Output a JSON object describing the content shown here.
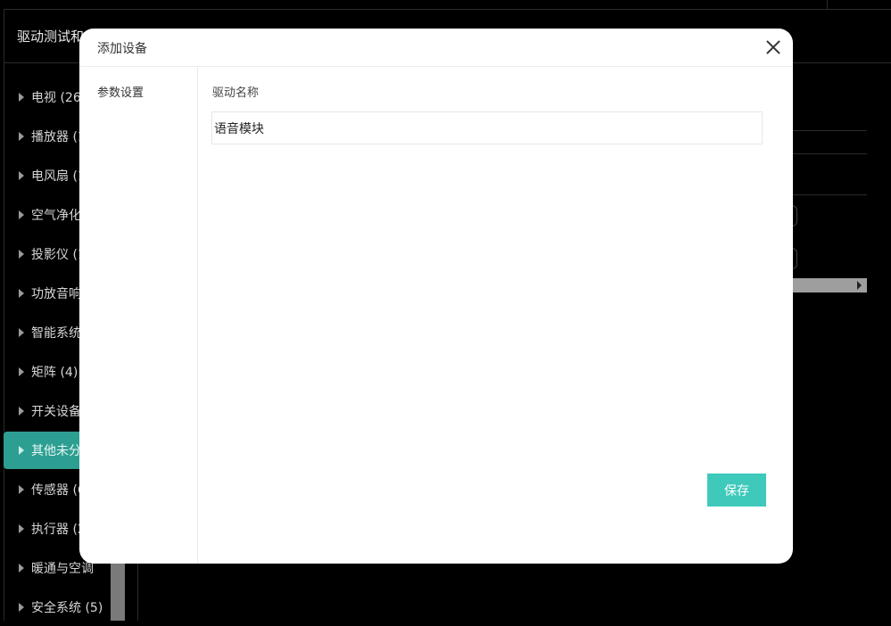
{
  "app": {
    "title": "驱动测试和"
  },
  "categories": [
    {
      "label": "电视 (26)",
      "active": false
    },
    {
      "label": "播放器 (1",
      "active": false
    },
    {
      "label": "电风扇 (1",
      "active": false
    },
    {
      "label": "空气净化",
      "active": false
    },
    {
      "label": "投影仪 (1",
      "active": false
    },
    {
      "label": "功放音响",
      "active": false
    },
    {
      "label": "智能系统",
      "active": false
    },
    {
      "label": "矩阵 (4)",
      "active": false
    },
    {
      "label": "开关设备",
      "active": false
    },
    {
      "label": "其他未分",
      "active": true
    },
    {
      "label": "传感器 (6",
      "active": false
    },
    {
      "label": "执行器 (2",
      "active": false
    },
    {
      "label": "暖通与空调",
      "active": false
    },
    {
      "label": "安全系统 (5)",
      "active": false
    }
  ],
  "modal": {
    "title": "添加设备",
    "tab": "参数设置",
    "field_label": "驱动名称",
    "field_value": "语音模块",
    "save_label": "保存"
  }
}
